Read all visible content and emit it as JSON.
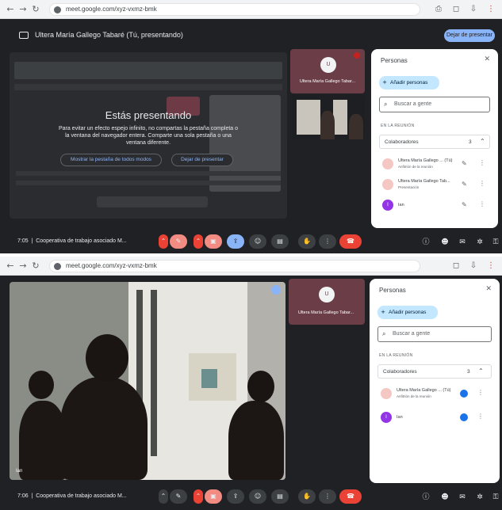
{
  "browser": {
    "url": "meet.google.com/xyz-vxmz-bmk"
  },
  "presentation": {
    "banner_text": "Ultera María Gallego Tabaré (Tú, presentando)",
    "stop_label": "Dejar de presentar",
    "overlay_title": "Estás presentando",
    "overlay_body": "Para evitar un efecto espejo infinito, no compartas la pestaña completa o la ventana del navegador entera. Comparte una sola pestaña o una ventana diferente.",
    "overlay_btn_1": "Mostrar la pestaña de todos modos",
    "overlay_btn_2": "Dejar de presentar"
  },
  "tiles": {
    "self_name": "Ultera María Gallego Tabar...",
    "self_initial": "U"
  },
  "people_panel": {
    "title": "Personas",
    "add_label": "Añadir personas",
    "search_placeholder": "Buscar a gente",
    "section_label": "EN LA REUNIÓN",
    "group_label": "Colaboradores",
    "group_count": "3",
    "people": [
      {
        "name": "Ultera María Gallego ... (Tú)",
        "role": "Anfitrión de la reunión"
      },
      {
        "name": "Ultera María Gallego Tab...",
        "role": "Presentación"
      },
      {
        "name": "Ian",
        "role": "",
        "initial": "I"
      }
    ]
  },
  "meeting": {
    "time_1": "7:05",
    "time_2": "7:06",
    "title": "Cooperativa de trabajo asociado M...",
    "separator": "|"
  },
  "video": {
    "label": "Ian"
  },
  "colors": {
    "accent": "#8ab4f8",
    "end_call": "#ea4335",
    "surface": "#202124"
  }
}
